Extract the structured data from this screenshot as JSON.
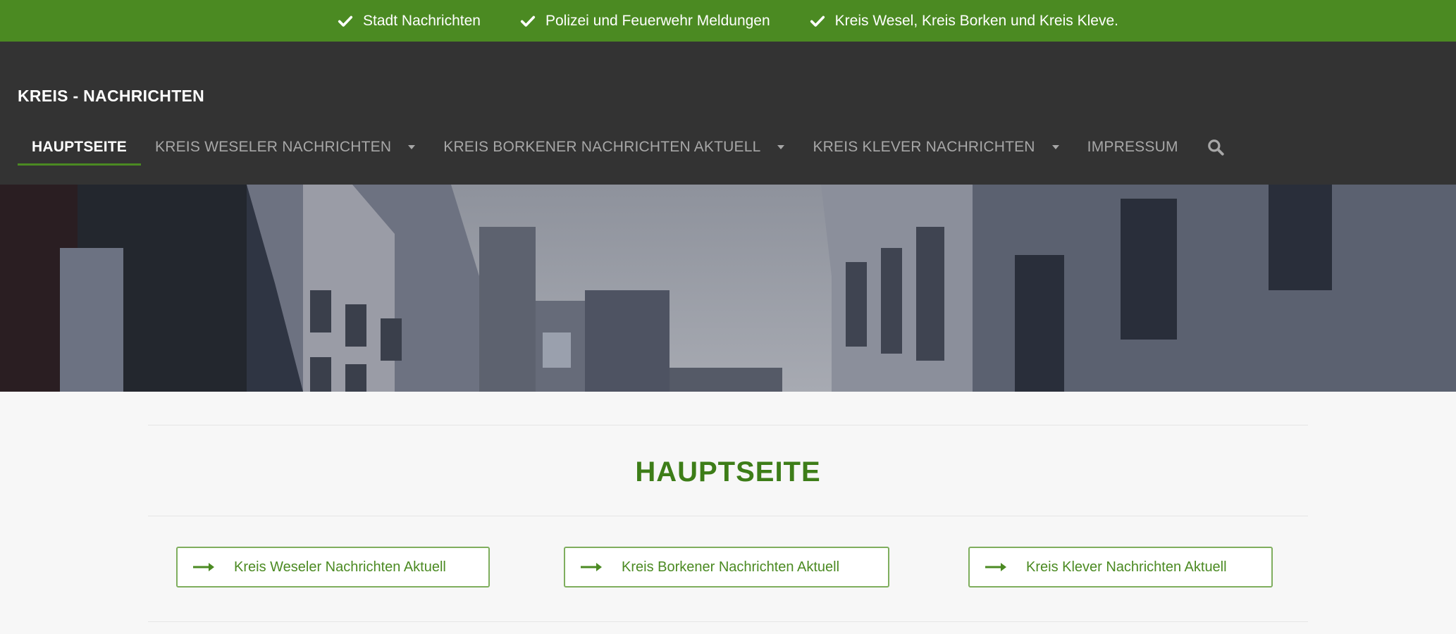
{
  "topbar": {
    "items": [
      {
        "icon": "check-icon",
        "label": "Stadt Nachrichten"
      },
      {
        "icon": "check-icon",
        "label": "Polizei und Feuerwehr Meldungen"
      },
      {
        "icon": "check-icon",
        "label": "Kreis Wesel, Kreis Borken und Kreis Kleve."
      }
    ]
  },
  "header": {
    "site_title": "KREIS - NACHRICHTEN",
    "nav": [
      {
        "label": "HAUPTSEITE",
        "active": true
      },
      {
        "label": "KREIS WESELER NACHRICHTEN",
        "has_dropdown": true
      },
      {
        "label": "KREIS BORKENER NACHRICHTEN AKTUELL",
        "has_dropdown": true
      },
      {
        "label": "KREIS KLEVER NACHRICHTEN",
        "has_dropdown": true
      },
      {
        "label": "IMPRESSUM"
      }
    ],
    "search_icon": "search-icon"
  },
  "main": {
    "page_title": "HAUPTSEITE",
    "buttons": [
      {
        "icon": "arrow-right-icon",
        "label": "Kreis Weseler Nachrichten Aktuell"
      },
      {
        "icon": "arrow-right-icon",
        "label": "Kreis Borkener Nachrichten Aktuell"
      },
      {
        "icon": "arrow-right-icon",
        "label": "Kreis Klever Nachrichten Aktuell"
      }
    ]
  },
  "colors": {
    "brand_green": "#4b8a22",
    "title_green": "#3d7d18",
    "header_dark": "#333333",
    "nav_text": "#a7a7a7"
  }
}
